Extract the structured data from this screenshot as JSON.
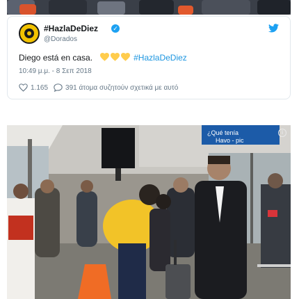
{
  "tweet": {
    "display_name": "#HazlaDeDiez",
    "handle": "@Dorados",
    "text_prefix": "Diego está en casa.",
    "hashtag": "#HazlaDeDiez",
    "timestamp": "10:49 μ.μ. - 8 Σεπ 2018",
    "likes": "1.165",
    "replies_text": "391 άτομα συζητούν σχετικά με αυτό"
  },
  "photo": {
    "sign_text_line1": "¿Qué tenía",
    "sign_text_line2": "Havo - pic"
  },
  "colors": {
    "accent": "#1da1f2",
    "hashtag": "#1b95e0",
    "heart": "#ffcc4d",
    "muted": "#657786"
  }
}
